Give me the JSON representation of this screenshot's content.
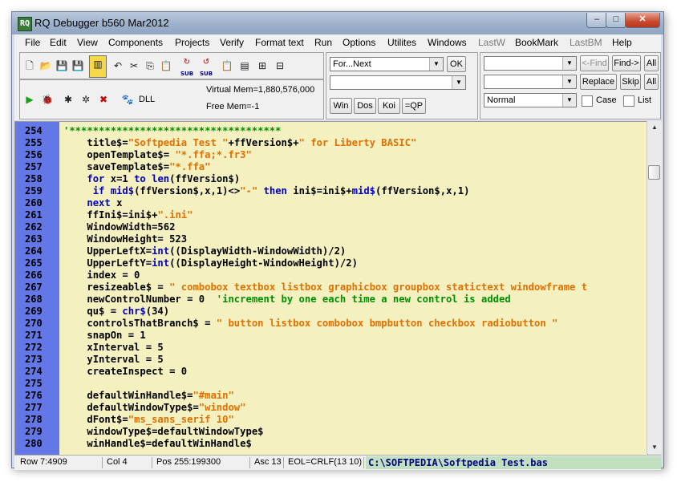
{
  "window": {
    "title": "RQ Debugger b560 Mar2012"
  },
  "menu": [
    "File",
    "Edit",
    "View",
    "Components",
    "Projects",
    "Verify",
    "Format text",
    "Run",
    "Options",
    "Utilites",
    "Windows",
    "LastW",
    "BookMark",
    "LastBM",
    "Help"
  ],
  "toolbar": {
    "sub1": "SUB",
    "sub2": "SUB",
    "dll": "DLL",
    "virtual_mem": "Virtual Mem=1,880,576,000",
    "free_mem": "Free Mem=-1"
  },
  "loop_combo": {
    "value": "For...Next",
    "ok": "OK"
  },
  "buttons": {
    "win": "Win",
    "dos": "Dos",
    "koi": "Koi",
    "qp": "=QP"
  },
  "find": {
    "prev": "<-Find",
    "next": "Find->",
    "all1": "All",
    "replace": "Replace",
    "skip": "Skip",
    "all2": "All",
    "mode": "Normal",
    "case": "Case",
    "list": "List"
  },
  "code": [
    {
      "n": "254",
      "t": "'************************************"
    },
    {
      "n": "255",
      "t": "    title$=\"Softpedia Test \"+ffVersion$+\" for Liberty BASIC\""
    },
    {
      "n": "256",
      "t": "    openTemplate$= \"*.ffa;*.fr3\""
    },
    {
      "n": "257",
      "t": "    saveTemplate$=\"*.ffa\""
    },
    {
      "n": "258",
      "t": "    for x=1 to len(ffVersion$)"
    },
    {
      "n": "259",
      "t": "     if mid$(ffVersion$,x,1)<>\"-\" then ini$=ini$+mid$(ffVersion$,x,1)"
    },
    {
      "n": "260",
      "t": "    next x"
    },
    {
      "n": "261",
      "t": "    ffIni$=ini$+\".ini\""
    },
    {
      "n": "262",
      "t": "    WindowWidth=562"
    },
    {
      "n": "263",
      "t": "    WindowHeight= 523"
    },
    {
      "n": "264",
      "t": "    UpperLeftX=int((DisplayWidth-WindowWidth)/2)"
    },
    {
      "n": "265",
      "t": "    UpperLeftY=int((DisplayHeight-WindowHeight)/2)"
    },
    {
      "n": "266",
      "t": "    index = 0"
    },
    {
      "n": "267",
      "t": "    resizeable$ = \" combobox textbox listbox graphicbox groupbox statictext windowframe t"
    },
    {
      "n": "268",
      "t": "    newControlNumber = 0  'increment by one each time a new control is added"
    },
    {
      "n": "269",
      "t": "    qu$ = chr$(34)"
    },
    {
      "n": "270",
      "t": "    controlsThatBranch$ = \" button listbox combobox bmpbutton checkbox radiobutton \""
    },
    {
      "n": "271",
      "t": "    snapOn = 1"
    },
    {
      "n": "272",
      "t": "    xInterval = 5"
    },
    {
      "n": "273",
      "t": "    yInterval = 5"
    },
    {
      "n": "274",
      "t": "    createInspect = 0"
    },
    {
      "n": "275",
      "t": ""
    },
    {
      "n": "276",
      "t": "    defaultWinHandle$=\"#main\""
    },
    {
      "n": "277",
      "t": "    defaultWindowType$=\"window\""
    },
    {
      "n": "278",
      "t": "    dFont$=\"ms_sans_serif 10\""
    },
    {
      "n": "279",
      "t": "    windowType$=defaultWindowType$"
    },
    {
      "n": "280",
      "t": "    winHandle$=defaultWinHandle$"
    }
  ],
  "status": {
    "row": "Row 7:4909",
    "col": "Col 4",
    "pos": "Pos 255:199300",
    "asc": "Asc 13",
    "eol": "EOL=CRLF(13 10)",
    "file": "C:\\SOFTPEDIA\\Softpedia Test.bas"
  },
  "colors": {
    "keyword": "#0000c0",
    "string": "#e07000",
    "comment": "#009000",
    "editor_bg": "#f4f0c0",
    "gutter_bg": "#6477e6"
  }
}
